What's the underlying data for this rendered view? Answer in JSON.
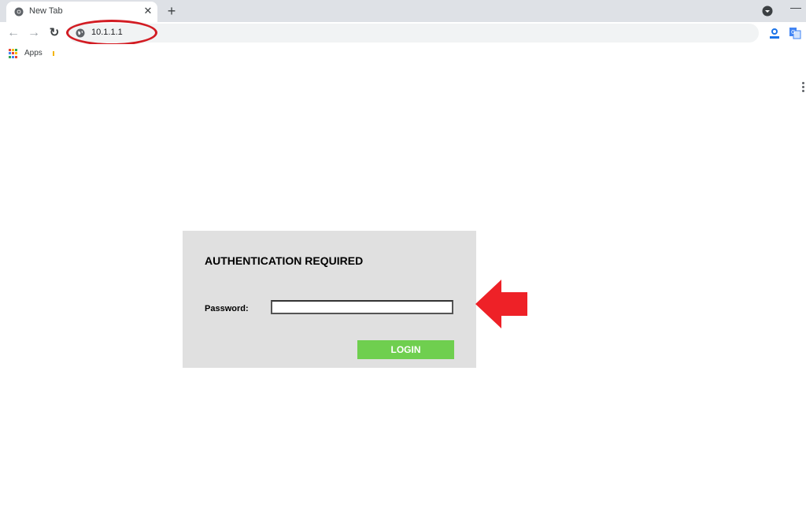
{
  "browser": {
    "tab": {
      "title": "New Tab",
      "close_glyph": "✕"
    },
    "new_tab_glyph": "+",
    "minimize_glyph": "—",
    "nav": {
      "back_glyph": "←",
      "forward_glyph": "→",
      "reload_glyph": "↻"
    },
    "address": {
      "url": "10.1.1.1",
      "icon": "globe-icon",
      "highlight_color": "#d21c23"
    },
    "bookmarks": {
      "apps_label": "Apps"
    },
    "extensions": [
      "profile-extension-icon",
      "translate-extension-icon"
    ]
  },
  "auth": {
    "title": "AUTHENTICATION REQUIRED",
    "password_label": "Password:",
    "password_value": "",
    "login_label": "LOGIN",
    "login_color": "#6fcf4f",
    "panel_color": "#e0e0e0"
  },
  "annotation": {
    "arrow_color": "#ee2127",
    "arrow_icon": "left-arrow-icon"
  }
}
